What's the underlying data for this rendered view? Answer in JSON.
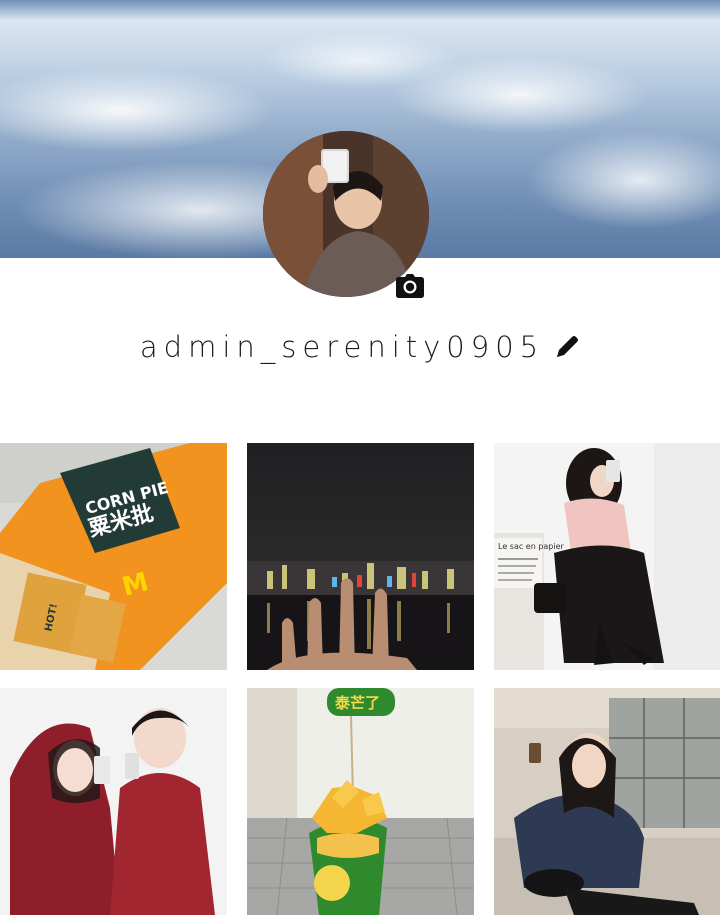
{
  "profile": {
    "username": "admin_serenity0905",
    "cover_description_icon": "cloud-cover-image",
    "avatar_icon": "profile-avatar-image",
    "camera_icon": "camera-icon",
    "edit_icon": "pencil-icon"
  },
  "posts": [
    {
      "name": "post-corn-pie",
      "badge_text": "CORN PIE",
      "badge_sub": "粟米批",
      "side_text": "HOT!"
    },
    {
      "name": "post-night-skyline"
    },
    {
      "name": "post-girl-mirror-selfie",
      "sign_text": "Le sac en papier"
    },
    {
      "name": "post-couple-hoodies"
    },
    {
      "name": "post-mango-dessert",
      "label_text": "泰芒了"
    },
    {
      "name": "post-girl-mall-selfie"
    }
  ],
  "colors": {
    "accent_text": "#1b1b1b",
    "background": "#ffffff"
  }
}
